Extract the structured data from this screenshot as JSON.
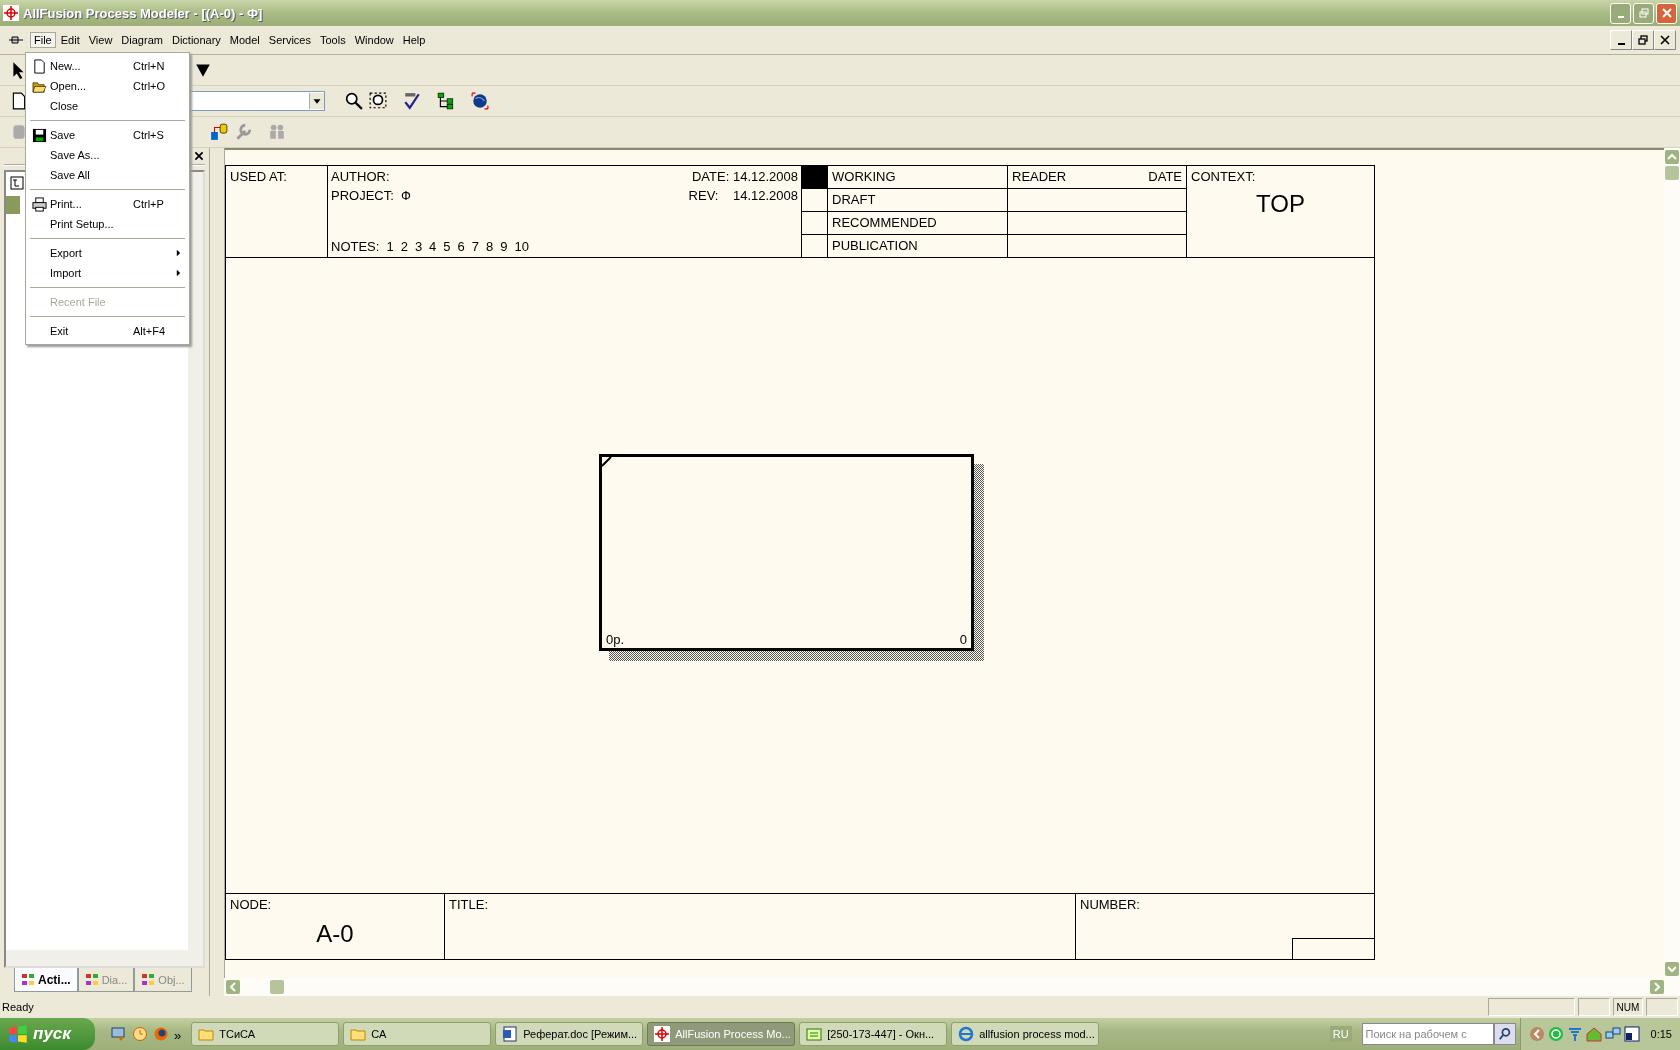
{
  "window": {
    "title": "AllFusion Process Modeler - [(A-0)  - Ф]"
  },
  "menu_bar": [
    {
      "label": "File",
      "selected": true
    },
    {
      "label": "Edit",
      "selected": false
    },
    {
      "label": "View",
      "selected": false
    },
    {
      "label": "Diagram",
      "selected": false
    },
    {
      "label": "Dictionary",
      "selected": false
    },
    {
      "label": "Model",
      "selected": false
    },
    {
      "label": "Services",
      "selected": false
    },
    {
      "label": "Tools",
      "selected": false
    },
    {
      "label": "Window",
      "selected": false
    },
    {
      "label": "Help",
      "selected": false
    }
  ],
  "file_menu": [
    {
      "kind": "item",
      "label": "New...",
      "shortcut": "Ctrl+N",
      "disabled": false
    },
    {
      "kind": "item",
      "label": "Open...",
      "shortcut": "Ctrl+O",
      "disabled": false
    },
    {
      "kind": "item",
      "label": "Close",
      "disabled": false
    },
    {
      "kind": "separator"
    },
    {
      "kind": "item",
      "label": "Save",
      "shortcut": "Ctrl+S",
      "disabled": false
    },
    {
      "kind": "item",
      "label": "Save As...",
      "disabled": false
    },
    {
      "kind": "item",
      "label": "Save All",
      "disabled": false
    },
    {
      "kind": "separator"
    },
    {
      "kind": "item",
      "label": "Print...",
      "shortcut": "Ctrl+P",
      "disabled": false
    },
    {
      "kind": "item",
      "label": "Print Setup...",
      "disabled": false
    },
    {
      "kind": "separator"
    },
    {
      "kind": "submenu",
      "label": "Export",
      "disabled": false
    },
    {
      "kind": "submenu",
      "label": "Import",
      "disabled": false
    },
    {
      "kind": "separator"
    },
    {
      "kind": "item",
      "label": "Recent File",
      "disabled": true
    },
    {
      "kind": "separator"
    },
    {
      "kind": "item",
      "label": "Exit",
      "shortcut": "Alt+F4",
      "disabled": false
    }
  ],
  "model_panel": {
    "tabs": [
      {
        "label": "Acti...",
        "selected": true
      },
      {
        "label": "Dia...",
        "selected": false
      },
      {
        "label": "Obj...",
        "selected": false
      }
    ]
  },
  "diagram": {
    "header": {
      "used_at": "USED AT:",
      "author": "AUTHOR:",
      "project_label": "PROJECT:",
      "project": "Ф",
      "notes_label": "NOTES:",
      "notes": [
        "1",
        "2",
        "3",
        "4",
        "5",
        "6",
        "7",
        "8",
        "9",
        "10"
      ],
      "date_label": "DATE:",
      "date": "14.12.2008",
      "rev_label": "REV:",
      "rev": "14.12.2008",
      "statuses": [
        {
          "label": "WORKING",
          "selected": true
        },
        {
          "label": "DRAFT",
          "selected": false
        },
        {
          "label": "RECOMMENDED",
          "selected": false
        },
        {
          "label": "PUBLICATION",
          "selected": false
        }
      ],
      "reader": "READER",
      "reader_date": "DATE",
      "context_label": "CONTEXT:",
      "context": "TOP"
    },
    "activity": {
      "name": "0р.",
      "number": "0"
    },
    "footer": {
      "node_label": "NODE:",
      "node": "A-0",
      "title_label": "TITLE:",
      "number_label": "NUMBER:"
    }
  },
  "status_bar": {
    "text": "Ready",
    "indicators": [
      "NUM"
    ]
  },
  "taskbar": {
    "start": "пуск",
    "more": "»",
    "tasks": [
      {
        "kind": "folder",
        "label": "ТСиСА",
        "selected": false
      },
      {
        "kind": "folder",
        "label": "СА",
        "selected": false
      },
      {
        "kind": "word",
        "label": "Реферат.doc [Режим...",
        "selected": false
      },
      {
        "kind": "modeler",
        "label": "AllFusion Process Mo...",
        "selected": true
      },
      {
        "kind": "chat",
        "label": "[250-173-447] - Окн...",
        "selected": false
      },
      {
        "kind": "browser",
        "label": "allfusion process mod...",
        "selected": false
      }
    ],
    "language": "RU",
    "search": {
      "placeholder": "Поиск на рабочем с"
    },
    "clock": "0:15"
  }
}
